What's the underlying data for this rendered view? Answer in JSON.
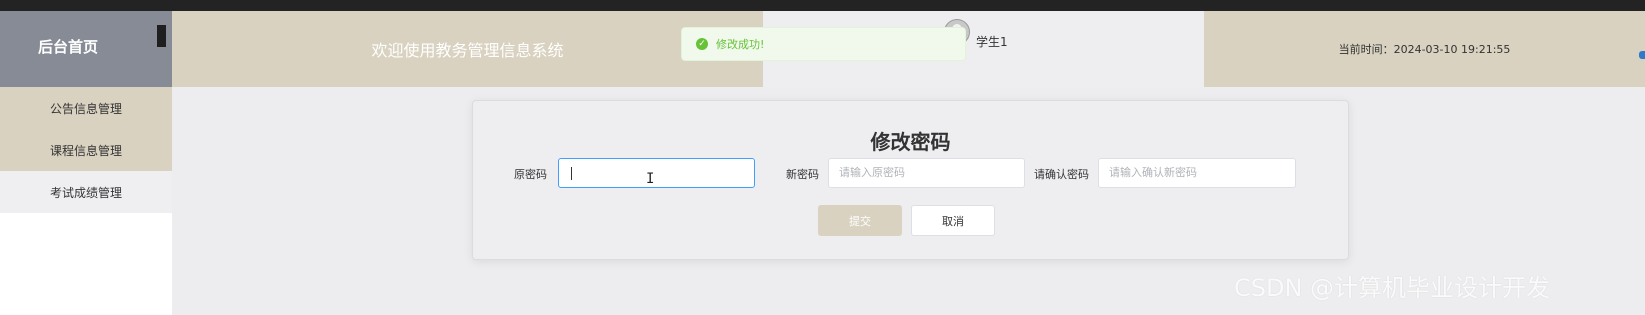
{
  "sidebar": {
    "brand_title": "后台首页",
    "items": [
      {
        "label": "公告信息管理"
      },
      {
        "label": "课程信息管理"
      },
      {
        "label": "考试成绩管理"
      }
    ]
  },
  "header": {
    "welcome": "欢迎使用教务管理信息系统",
    "username": "学生1",
    "time_label": "当前时间：",
    "time_value": "2024-03-10 19:21:55"
  },
  "toast": {
    "icon": "check-circle-icon",
    "message": "修改成功!"
  },
  "form": {
    "title": "修改密码",
    "old_password": {
      "label": "原密码",
      "value": ""
    },
    "new_password": {
      "label": "新密码",
      "placeholder": "请输入原密码"
    },
    "confirm_password": {
      "label": "请确认密码",
      "placeholder": "请输入确认新密码"
    },
    "submit_label": "提交",
    "cancel_label": "取消"
  },
  "watermark": "CSDN @计算机毕业设计开发",
  "colors": {
    "accent_beige": "#d9d2c1",
    "brand_gray": "#868b96",
    "success_green": "#67c23a",
    "focus_blue": "#409eff"
  }
}
